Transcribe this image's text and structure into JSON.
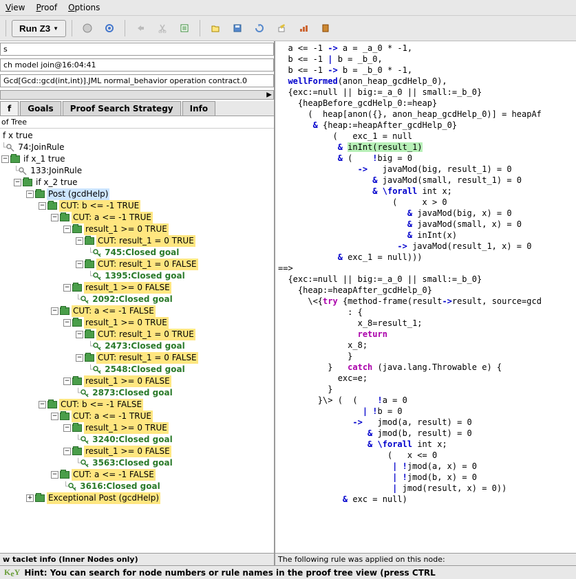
{
  "menu": {
    "view": "View",
    "proof": "Proof",
    "options": "Options"
  },
  "toolbar": {
    "run": "Run Z3"
  },
  "header": {
    "line1": "s",
    "line2": "ch model join@16:04:41",
    "line3": "Gcd[Gcd::gcd(int,int)].JML normal_behavior operation contract.0"
  },
  "tabs": {
    "t1": "f",
    "t2": "Goals",
    "t3": "Proof Search Strategy",
    "t4": "Info"
  },
  "tree_header": "of Tree",
  "footer_left": "w taclet info (Inner Nodes only)",
  "footer_right": "The following rule was applied on this node:",
  "statusbar": {
    "logo": "KeY",
    "hint": "Hint: You can search for node numbers or rule names in the proof tree view (press CTRL"
  },
  "tree": [
    {
      "d": 0,
      "type": "text",
      "label": "f x true"
    },
    {
      "d": 0,
      "type": "key",
      "label": "74:JoinRule"
    },
    {
      "d": 0,
      "type": "folder",
      "toggle": "-",
      "label": "if x_1 true"
    },
    {
      "d": 1,
      "type": "key",
      "label": "133:JoinRule"
    },
    {
      "d": 1,
      "type": "folder",
      "toggle": "-",
      "label": "if x_2 true"
    },
    {
      "d": 2,
      "type": "folder",
      "toggle": "-",
      "label": "Post (gcdHelp)",
      "hl": "blue"
    },
    {
      "d": 3,
      "type": "folder",
      "toggle": "-",
      "label": "CUT: b <= -1 TRUE",
      "hl": "yellow"
    },
    {
      "d": 4,
      "type": "folder",
      "toggle": "-",
      "label": "CUT: a <= -1 TRUE",
      "hl": "yellow"
    },
    {
      "d": 5,
      "type": "folder",
      "toggle": "-",
      "label": "result_1 >= 0 TRUE",
      "hl": "yellow"
    },
    {
      "d": 6,
      "type": "folder",
      "toggle": "-",
      "label": "CUT: result_1 = 0 TRUE",
      "hl": "yellow"
    },
    {
      "d": 7,
      "type": "closed",
      "label": "745:Closed goal"
    },
    {
      "d": 6,
      "type": "folder",
      "toggle": "-",
      "label": "CUT: result_1 = 0 FALSE",
      "hl": "yellow"
    },
    {
      "d": 7,
      "type": "closed",
      "label": "1395:Closed goal"
    },
    {
      "d": 5,
      "type": "folder",
      "toggle": "-",
      "label": "result_1 >= 0 FALSE",
      "hl": "yellow"
    },
    {
      "d": 6,
      "type": "closed",
      "label": "2092:Closed goal"
    },
    {
      "d": 4,
      "type": "folder",
      "toggle": "-",
      "label": "CUT: a <= -1 FALSE",
      "hl": "yellow"
    },
    {
      "d": 5,
      "type": "folder",
      "toggle": "-",
      "label": "result_1 >= 0 TRUE",
      "hl": "yellow"
    },
    {
      "d": 6,
      "type": "folder",
      "toggle": "-",
      "label": "CUT: result_1 = 0 TRUE",
      "hl": "yellow"
    },
    {
      "d": 7,
      "type": "closed",
      "label": "2473:Closed goal"
    },
    {
      "d": 6,
      "type": "folder",
      "toggle": "-",
      "label": "CUT: result_1 = 0 FALSE",
      "hl": "yellow"
    },
    {
      "d": 7,
      "type": "closed",
      "label": "2548:Closed goal"
    },
    {
      "d": 5,
      "type": "folder",
      "toggle": "-",
      "label": "result_1 >= 0 FALSE",
      "hl": "yellow"
    },
    {
      "d": 6,
      "type": "closed",
      "label": "2873:Closed goal"
    },
    {
      "d": 3,
      "type": "folder",
      "toggle": "-",
      "label": "CUT: b <= -1 FALSE",
      "hl": "yellow"
    },
    {
      "d": 4,
      "type": "folder",
      "toggle": "-",
      "label": "CUT: a <= -1 TRUE",
      "hl": "yellow"
    },
    {
      "d": 5,
      "type": "folder",
      "toggle": "-",
      "label": "result_1 >= 0 TRUE",
      "hl": "yellow"
    },
    {
      "d": 6,
      "type": "closed",
      "label": "3240:Closed goal"
    },
    {
      "d": 5,
      "type": "folder",
      "toggle": "-",
      "label": "result_1 >= 0 FALSE",
      "hl": "yellow"
    },
    {
      "d": 6,
      "type": "closed",
      "label": "3563:Closed goal"
    },
    {
      "d": 4,
      "type": "folder",
      "toggle": "-",
      "label": "CUT: a <= -1 FALSE",
      "hl": "yellow"
    },
    {
      "d": 5,
      "type": "closed",
      "label": "3616:Closed goal"
    },
    {
      "d": 2,
      "type": "folder",
      "toggle": "+",
      "label": "Exceptional Post (gcdHelp)",
      "hl": "yellow"
    }
  ],
  "code_lines": [
    [
      {
        "t": "  a <= -1 "
      },
      {
        "t": "->",
        "c": "kw-blue"
      },
      {
        "t": " a = _a_0 * -1,"
      }
    ],
    [
      {
        "t": "  b <= -1 "
      },
      {
        "t": "|",
        "c": "kw-blue"
      },
      {
        "t": " b = _b_0,"
      }
    ],
    [
      {
        "t": "  b <= -1 "
      },
      {
        "t": "->",
        "c": "kw-blue"
      },
      {
        "t": " b = _b_0 * -1,"
      }
    ],
    [
      {
        "t": "  "
      },
      {
        "t": "wellFormed",
        "c": "kw-blue"
      },
      {
        "t": "(anon_heap_gcdHelp_0),"
      }
    ],
    [
      {
        "t": "  {exc:=null || big:=_a_0 || small:=_b_0}"
      }
    ],
    [
      {
        "t": "    {heapBefore_gcdHelp_0:=heap}"
      }
    ],
    [
      {
        "t": "      (  heap[anon({}, anon_heap_gcdHelp_0)] = heapAf"
      }
    ],
    [
      {
        "t": "       "
      },
      {
        "t": "&",
        "c": "kw-blue"
      },
      {
        "t": " {heap:=heapAfter_gcdHelp_0}"
      }
    ],
    [
      {
        "t": "           (   exc_1 = null"
      }
    ],
    [
      {
        "t": "            "
      },
      {
        "t": "&",
        "c": "kw-blue"
      },
      {
        "t": " "
      },
      {
        "t": "inInt(result_1)",
        "c": "green-bg"
      }
    ],
    [
      {
        "t": "            "
      },
      {
        "t": "&",
        "c": "kw-blue"
      },
      {
        "t": " (    "
      },
      {
        "t": "!",
        "c": "kw-blue"
      },
      {
        "t": "big = 0"
      }
    ],
    [
      {
        "t": "                "
      },
      {
        "t": "->",
        "c": "kw-blue"
      },
      {
        "t": "   javaMod(big, result_1) = 0"
      }
    ],
    [
      {
        "t": "                   "
      },
      {
        "t": "&",
        "c": "kw-blue"
      },
      {
        "t": " javaMod(small, result_1) = 0"
      }
    ],
    [
      {
        "t": "                   "
      },
      {
        "t": "&",
        "c": "kw-blue"
      },
      {
        "t": " "
      },
      {
        "t": "\\forall",
        "c": "kw-blue"
      },
      {
        "t": " int x;"
      }
    ],
    [
      {
        "t": "                       (     x > 0"
      }
    ],
    [
      {
        "t": "                          "
      },
      {
        "t": "&",
        "c": "kw-blue"
      },
      {
        "t": " javaMod(big, x) = 0"
      }
    ],
    [
      {
        "t": "                          "
      },
      {
        "t": "&",
        "c": "kw-blue"
      },
      {
        "t": " javaMod(small, x) = 0"
      }
    ],
    [
      {
        "t": "                          "
      },
      {
        "t": "&",
        "c": "kw-blue"
      },
      {
        "t": " inInt(x)"
      }
    ],
    [
      {
        "t": "                        "
      },
      {
        "t": "->",
        "c": "kw-blue"
      },
      {
        "t": " javaMod(result_1, x) = 0"
      }
    ],
    [
      {
        "t": "            "
      },
      {
        "t": "&",
        "c": "kw-blue"
      },
      {
        "t": " exc_1 = null)))"
      }
    ],
    [
      {
        "t": "==>"
      }
    ],
    [
      {
        "t": "  {exc:=null || big:=_a_0 || small:=_b_0}"
      }
    ],
    [
      {
        "t": "    {heap:=heapAfter_gcdHelp_0}"
      }
    ],
    [
      {
        "t": "      \\<{"
      },
      {
        "t": "try",
        "c": "kw-purple"
      },
      {
        "t": " {method-frame(result"
      },
      {
        "t": "->",
        "c": "kw-blue"
      },
      {
        "t": "result, source=gcd"
      }
    ],
    [
      {
        "t": "              : {"
      }
    ],
    [
      {
        "t": "                x_8=result_1;"
      }
    ],
    [
      {
        "t": "                "
      },
      {
        "t": "return",
        "c": "kw-purple"
      }
    ],
    [
      {
        "t": "              x_8;"
      }
    ],
    [
      {
        "t": "              }"
      }
    ],
    [
      {
        "t": "          }   "
      },
      {
        "t": "catch",
        "c": "kw-purple"
      },
      {
        "t": " (java.lang.Throwable e) {"
      }
    ],
    [
      {
        "t": "            exc=e;"
      }
    ],
    [
      {
        "t": "          }"
      }
    ],
    [
      {
        "t": "        }\\> (  (    "
      },
      {
        "t": "!",
        "c": "kw-blue"
      },
      {
        "t": "a = 0"
      }
    ],
    [
      {
        "t": "                 "
      },
      {
        "t": "|",
        "c": "kw-blue"
      },
      {
        "t": " "
      },
      {
        "t": "!",
        "c": "kw-blue"
      },
      {
        "t": "b = 0"
      }
    ],
    [
      {
        "t": "               "
      },
      {
        "t": "->",
        "c": "kw-blue"
      },
      {
        "t": "   jmod(a, result) = 0"
      }
    ],
    [
      {
        "t": "                  "
      },
      {
        "t": "&",
        "c": "kw-blue"
      },
      {
        "t": " jmod(b, result) = 0"
      }
    ],
    [
      {
        "t": "                  "
      },
      {
        "t": "&",
        "c": "kw-blue"
      },
      {
        "t": " "
      },
      {
        "t": "\\forall",
        "c": "kw-blue"
      },
      {
        "t": " int x;"
      }
    ],
    [
      {
        "t": "                      (   x <= 0"
      }
    ],
    [
      {
        "t": "                       "
      },
      {
        "t": "|",
        "c": "kw-blue"
      },
      {
        "t": " "
      },
      {
        "t": "!",
        "c": "kw-blue"
      },
      {
        "t": "jmod(a, x) = 0"
      }
    ],
    [
      {
        "t": "                       "
      },
      {
        "t": "|",
        "c": "kw-blue"
      },
      {
        "t": " "
      },
      {
        "t": "!",
        "c": "kw-blue"
      },
      {
        "t": "jmod(b, x) = 0"
      }
    ],
    [
      {
        "t": "                       "
      },
      {
        "t": "|",
        "c": "kw-blue"
      },
      {
        "t": " jmod(result, x) = 0))"
      }
    ],
    [
      {
        "t": "             "
      },
      {
        "t": "&",
        "c": "kw-blue"
      },
      {
        "t": " exc = null)"
      }
    ]
  ]
}
